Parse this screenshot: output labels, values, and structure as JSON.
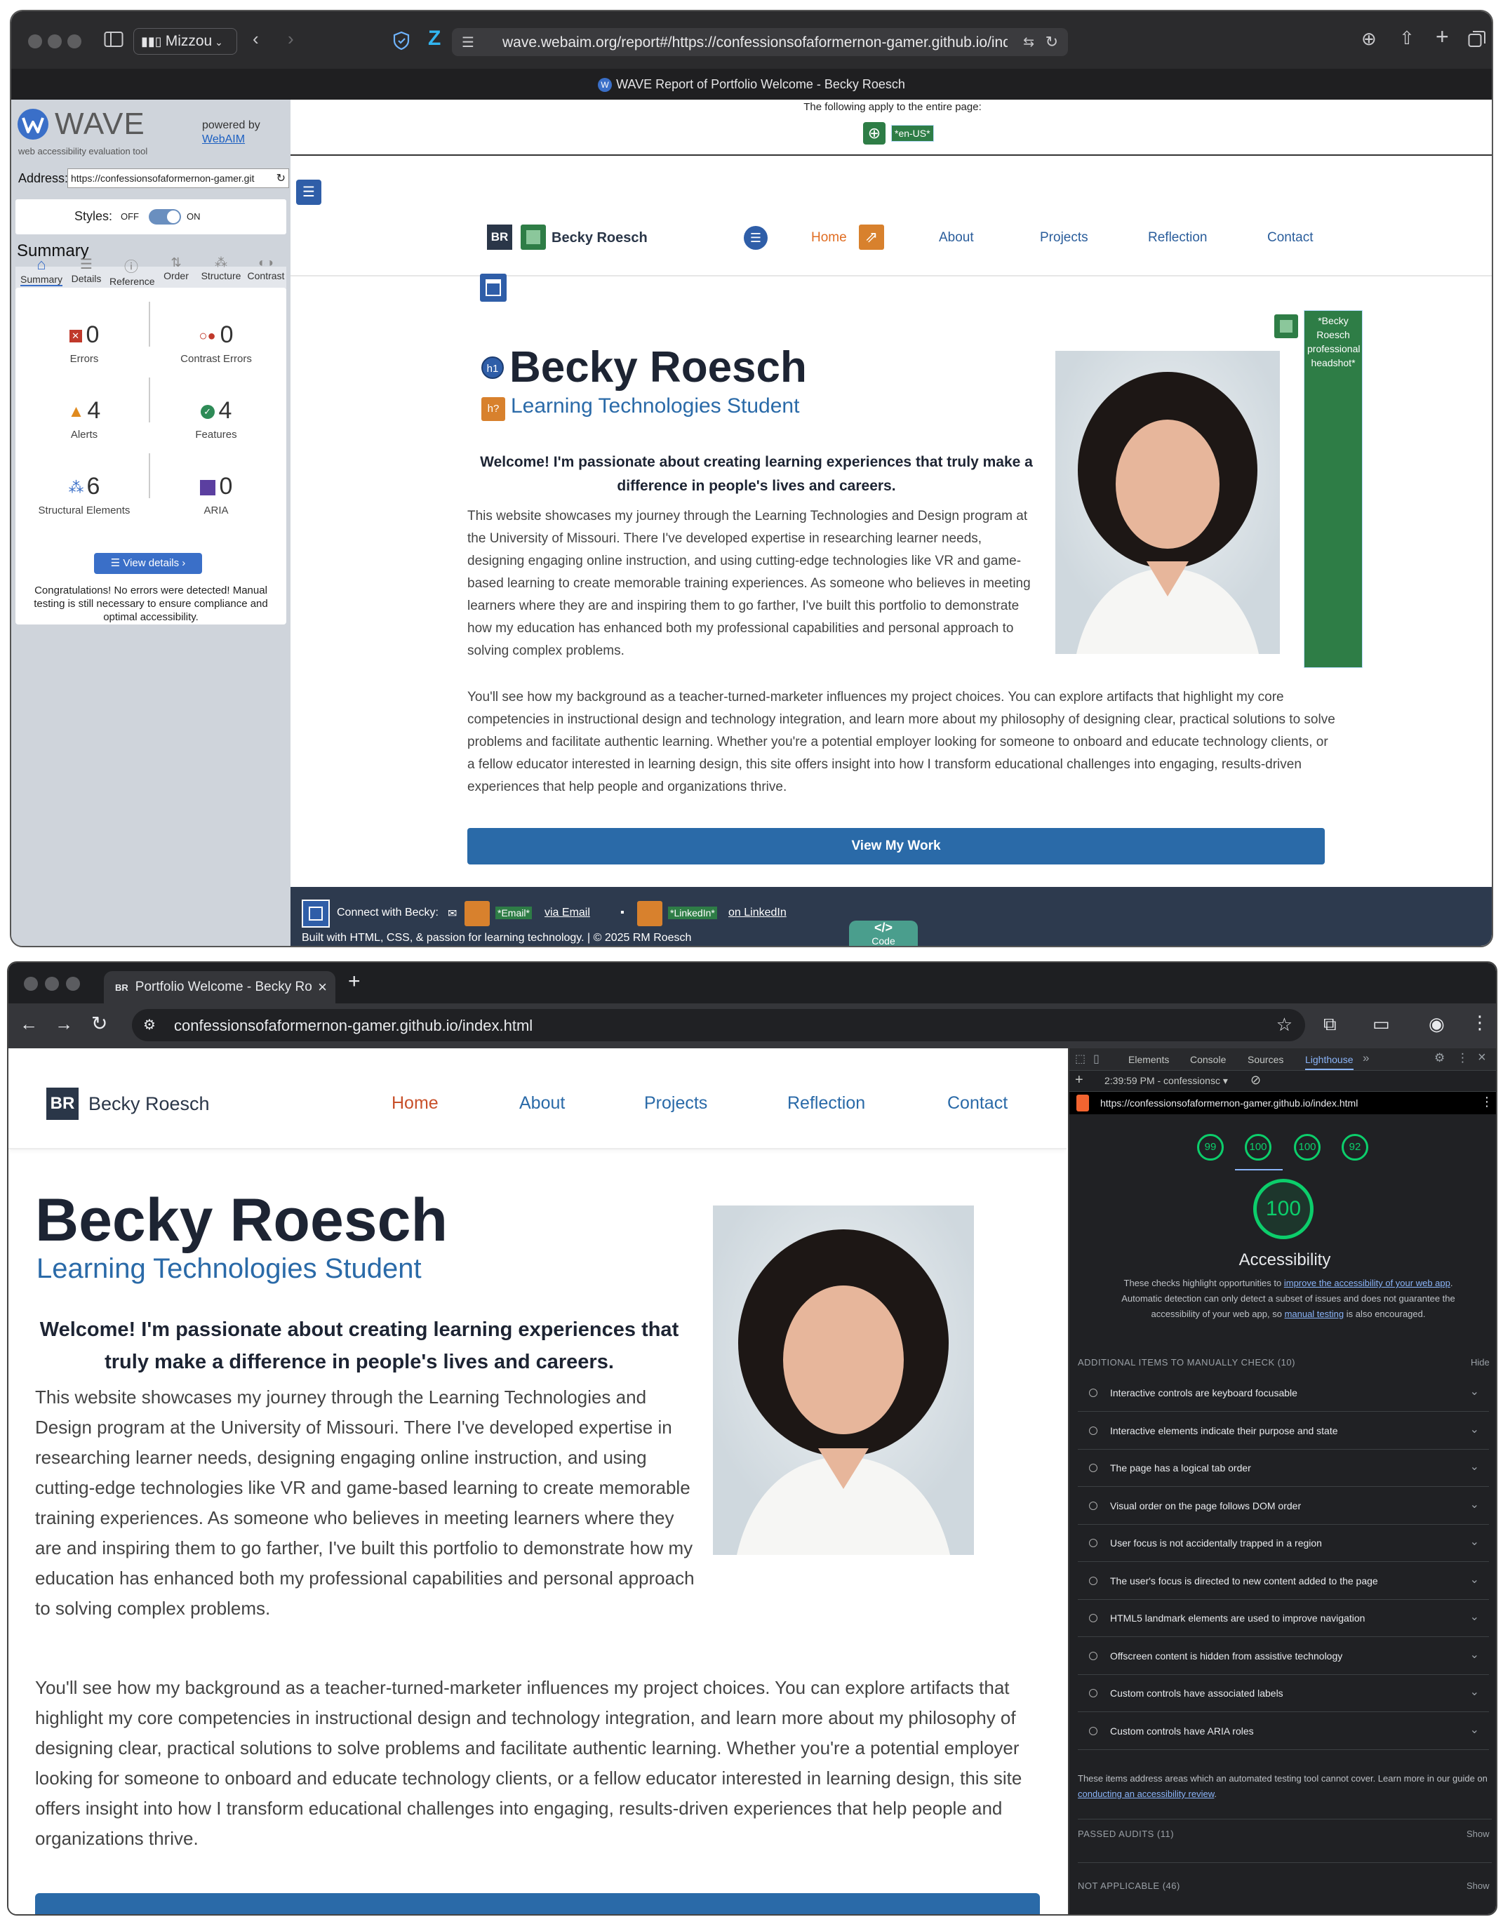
{
  "safari": {
    "profile": "Mizzou",
    "url": "wave.webaim.org/report#/https://confessionsofaformernon-gamer.github.io/index.h",
    "tab_title": "WAVE Report of Portfolio Welcome - Becky Roesch"
  },
  "wave": {
    "logo": "WAVE",
    "tagline": "web accessibility evaluation tool",
    "powered_by": "powered by",
    "webaim": "WebAIM",
    "address_label": "Address:",
    "address_value": "https://confessionsofaformernon-gamer.git",
    "styles_label": "Styles:",
    "styles_off": "OFF",
    "styles_on": "ON",
    "summary_heading": "Summary",
    "tabs": [
      "Summary",
      "Details",
      "Reference",
      "Order",
      "Structure",
      "Contrast"
    ],
    "stats": {
      "errors": {
        "value": "0",
        "label": "Errors"
      },
      "contrast": {
        "value": "0",
        "label": "Contrast Errors"
      },
      "alerts": {
        "value": "4",
        "label": "Alerts"
      },
      "features": {
        "value": "4",
        "label": "Features"
      },
      "structural": {
        "value": "6",
        "label": "Structural Elements"
      },
      "aria": {
        "value": "0",
        "label": "ARIA"
      }
    },
    "view_details": "View details ›",
    "congrats": "Congratulations! No errors were detected! Manual testing is still necessary to ensure compliance and optimal accessibility.",
    "applies": "The following apply to the entire page:",
    "lang_badge": "*en-US*",
    "alt_badge": "*Becky Roesch professional headshot*"
  },
  "wave_site": {
    "brand_initials": "BR",
    "brand_name": "Becky Roesch",
    "nav": [
      "Home",
      "About",
      "Projects",
      "Reflection",
      "Contact"
    ],
    "h1_badge": "h1",
    "h2_badge": "h?",
    "cta": "View My Work",
    "footer_connect": "Connect with Becky:",
    "footer_email_badge": "*Email*",
    "footer_email_link": "via Email",
    "footer_linkedin_badge": "*LinkedIn*",
    "footer_linkedin_link": "on LinkedIn",
    "footer_built": "Built with HTML, CSS, & passion for learning technology. | © 2025 RM Roesch",
    "code_badge": "Code"
  },
  "site": {
    "name": "Becky Roesch",
    "subtitle": "Learning Technologies Student",
    "welcome": "Welcome! I'm passionate about creating learning experiences that truly make a difference in people's lives and careers.",
    "para1": "This website showcases my journey through the Learning Technologies and Design program at the University of Missouri. There I've developed expertise in researching learner needs, designing engaging online instruction, and using cutting-edge technologies like VR and game-based learning to create memorable training experiences. As someone who believes in meeting learners where they are and inspiring them to go farther, I've built this portfolio to demonstrate how my education has enhanced both my professional capabilities and personal approach to solving complex problems.",
    "para2": "You'll see how my background as a teacher-turned-marketer influences my project choices. You can explore artifacts that highlight my core competencies in instructional design and technology integration, and learn more about my philosophy of designing clear, practical solutions to solve problems and facilitate authentic learning. Whether you're a potential employer looking for someone to onboard and educate technology clients, or a fellow educator interested in learning design, this site offers insight into how I transform educational challenges into engaging, results-driven experiences that help people and organizations thrive."
  },
  "chrome": {
    "tab_title": "Portfolio Welcome - Becky Ro",
    "tab_favicon": "BR",
    "url": "confessionsofaformernon-gamer.github.io/index.html"
  },
  "devtools": {
    "tabs": [
      "Elements",
      "Console",
      "Sources",
      "Lighthouse"
    ],
    "session": "2:39:59 PM - confessionsc",
    "report_url": "https://confessionsofaformernon-gamer.github.io/index.html",
    "scores": [
      "99",
      "100",
      "100",
      "92"
    ],
    "main_score": "100",
    "category": "Accessibility",
    "desc_1": "These checks highlight opportunities to ",
    "desc_link1": "improve the accessibility of your web app",
    "desc_2": ". Automatic detection can only detect a subset of issues and does not guarantee the accessibility of your web app, so ",
    "desc_link2": "manual testing",
    "desc_3": " is also encouraged.",
    "manual_header": "ADDITIONAL ITEMS TO MANUALLY CHECK (10)",
    "hide": "Hide",
    "audits": [
      "Interactive controls are keyboard focusable",
      "Interactive elements indicate their purpose and state",
      "The page has a logical tab order",
      "Visual order on the page follows DOM order",
      "User focus is not accidentally trapped in a region",
      "The user's focus is directed to new content added to the page",
      "HTML5 landmark elements are used to improve navigation",
      "Offscreen content is hidden from assistive technology",
      "Custom controls have associated labels",
      "Custom controls have ARIA roles"
    ],
    "footer_note": "These items address areas which an automated testing tool cannot cover. Learn more in our guide on ",
    "footer_link": "conducting an accessibility review",
    "passed": "PASSED AUDITS (11)",
    "not_applicable": "NOT APPLICABLE (46)",
    "show": "Show"
  }
}
